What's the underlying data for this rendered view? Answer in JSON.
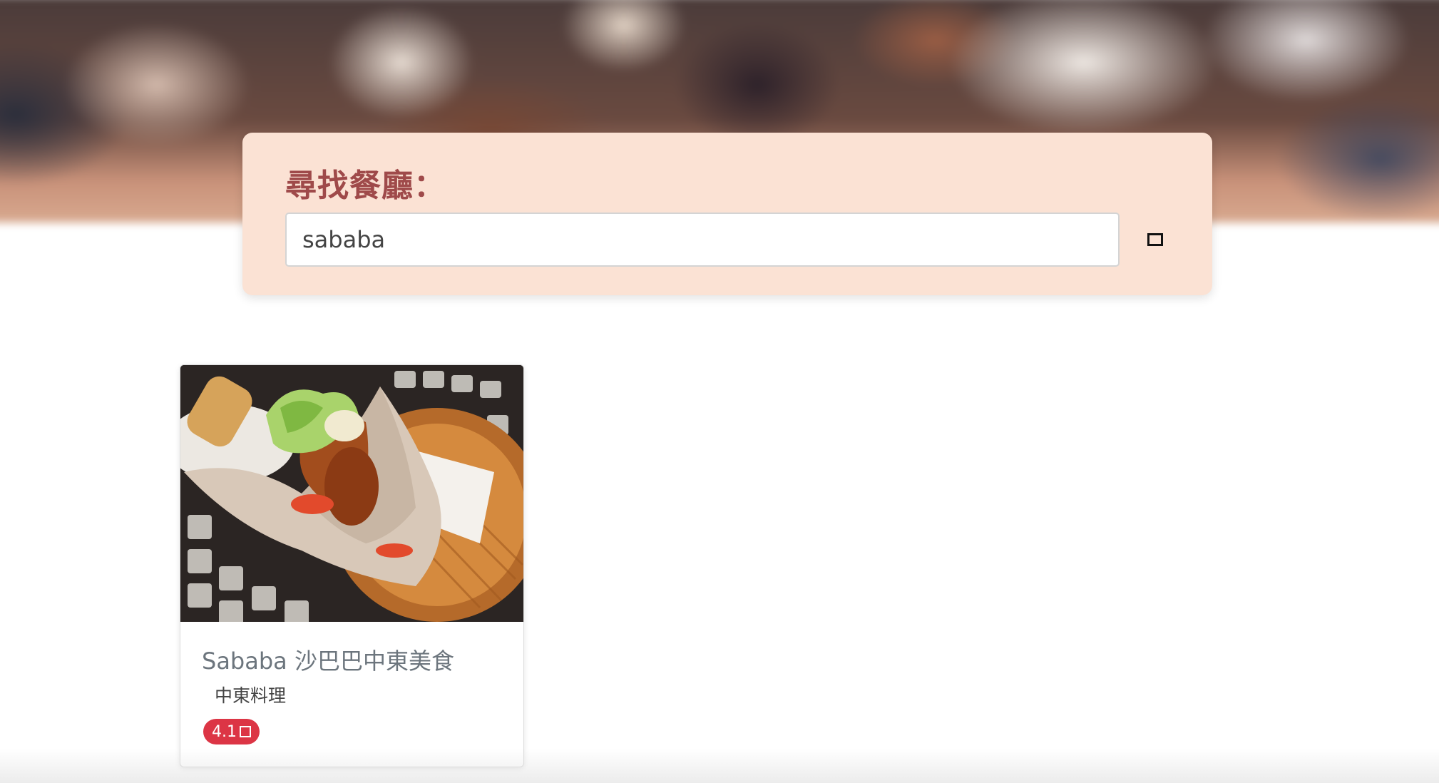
{
  "search": {
    "title": "尋找餐廳：",
    "value": "sababa",
    "button_icon": "search-icon"
  },
  "results": [
    {
      "name": "Sababa 沙巴巴中東美食",
      "category": "中東料理",
      "rating": "4.1",
      "rating_icon": "star-icon",
      "image_icon": "restaurant-photo"
    }
  ],
  "colors": {
    "search_card_bg": "#fbe2d4",
    "search_title": "#9f4a4a",
    "rating_badge": "#dc3545",
    "card_name": "#6c757d"
  }
}
